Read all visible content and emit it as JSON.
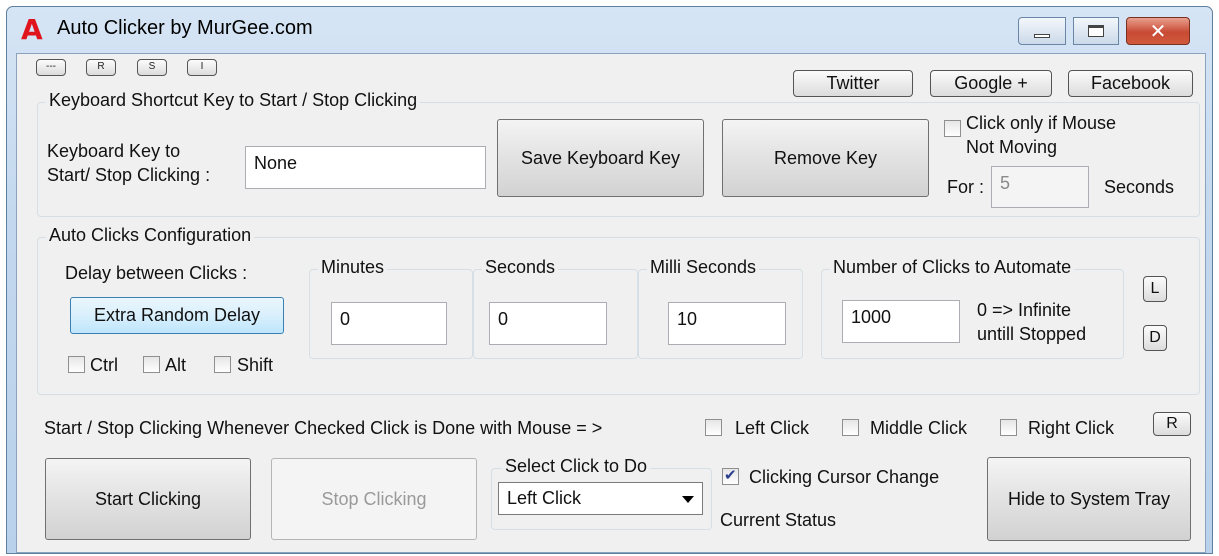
{
  "window": {
    "title": "Auto Clicker by MurGee.com",
    "icon_letter": "A",
    "close_glyph": "✕"
  },
  "top_bar": {
    "tiny_buttons": [
      "---",
      "R",
      "S",
      "I"
    ],
    "twitter": "Twitter",
    "google_plus": "Google +",
    "facebook": "Facebook"
  },
  "shortcut_group": {
    "title": "Keyboard Shortcut Key to Start / Stop Clicking",
    "key_label_line1": "Keyboard Key to",
    "key_label_line2": "Start/ Stop Clicking :",
    "key_value": "None",
    "save_button": "Save Keyboard Key",
    "remove_button": "Remove Key",
    "mouse_not_moving_line1": "Click only if Mouse",
    "mouse_not_moving_line2": "Not Moving",
    "mouse_not_moving_checked": false,
    "for_label": "For :",
    "for_value": "5",
    "seconds_label": "Seconds"
  },
  "config_group": {
    "title": "Auto Clicks Configuration",
    "delay_label": "Delay between Clicks :",
    "random_delay_button": "Extra Random Delay",
    "ctrl_label": "Ctrl",
    "alt_label": "Alt",
    "shift_label": "Shift",
    "minutes_title": "Minutes",
    "minutes_value": "0",
    "seconds_title": "Seconds",
    "seconds_value": "0",
    "ms_title": "Milli Seconds",
    "ms_value": "10",
    "clicks_title": "Number of Clicks to Automate",
    "clicks_value": "1000",
    "infinite_line1": "0 => Infinite",
    "infinite_line2": "untill Stopped",
    "l_button": "L",
    "d_button": "D"
  },
  "mouse_row": {
    "text": "Start / Stop Clicking Whenever Checked Click is Done with Mouse = >",
    "left_click": "Left Click",
    "middle_click": "Middle Click",
    "right_click": "Right Click",
    "r_button": "R"
  },
  "bottom": {
    "start_button": "Start Clicking",
    "stop_button": "Stop Clicking",
    "select_title": "Select Click to Do",
    "select_value": "Left Click",
    "cursor_change_label": "Clicking Cursor Change",
    "cursor_change_checked": true,
    "current_status_label": "Current Status",
    "hide_button": "Hide to System Tray"
  }
}
